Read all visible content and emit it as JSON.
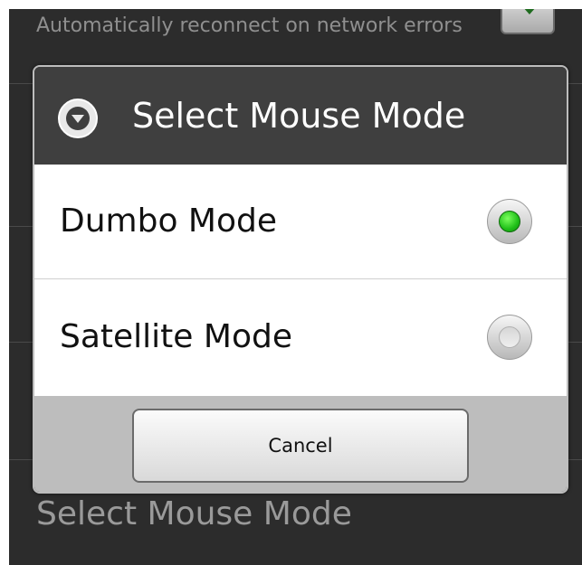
{
  "background": {
    "top_setting_text": "Automatically reconnect on network errors",
    "bottom_setting_title": "Select Mouse Mode",
    "checkbox_checked": true
  },
  "dialog": {
    "title": "Select Mouse Mode",
    "title_icon": "dropdown-circle-icon",
    "options": [
      {
        "label": "Dumbo Mode",
        "selected": true
      },
      {
        "label": "Satellite Mode",
        "selected": false
      }
    ],
    "cancel_label": "Cancel"
  },
  "colors": {
    "header_bg": "#3f3f3f",
    "footer_bg": "#bdbdbd",
    "radio_selected": "#1fbf18"
  }
}
